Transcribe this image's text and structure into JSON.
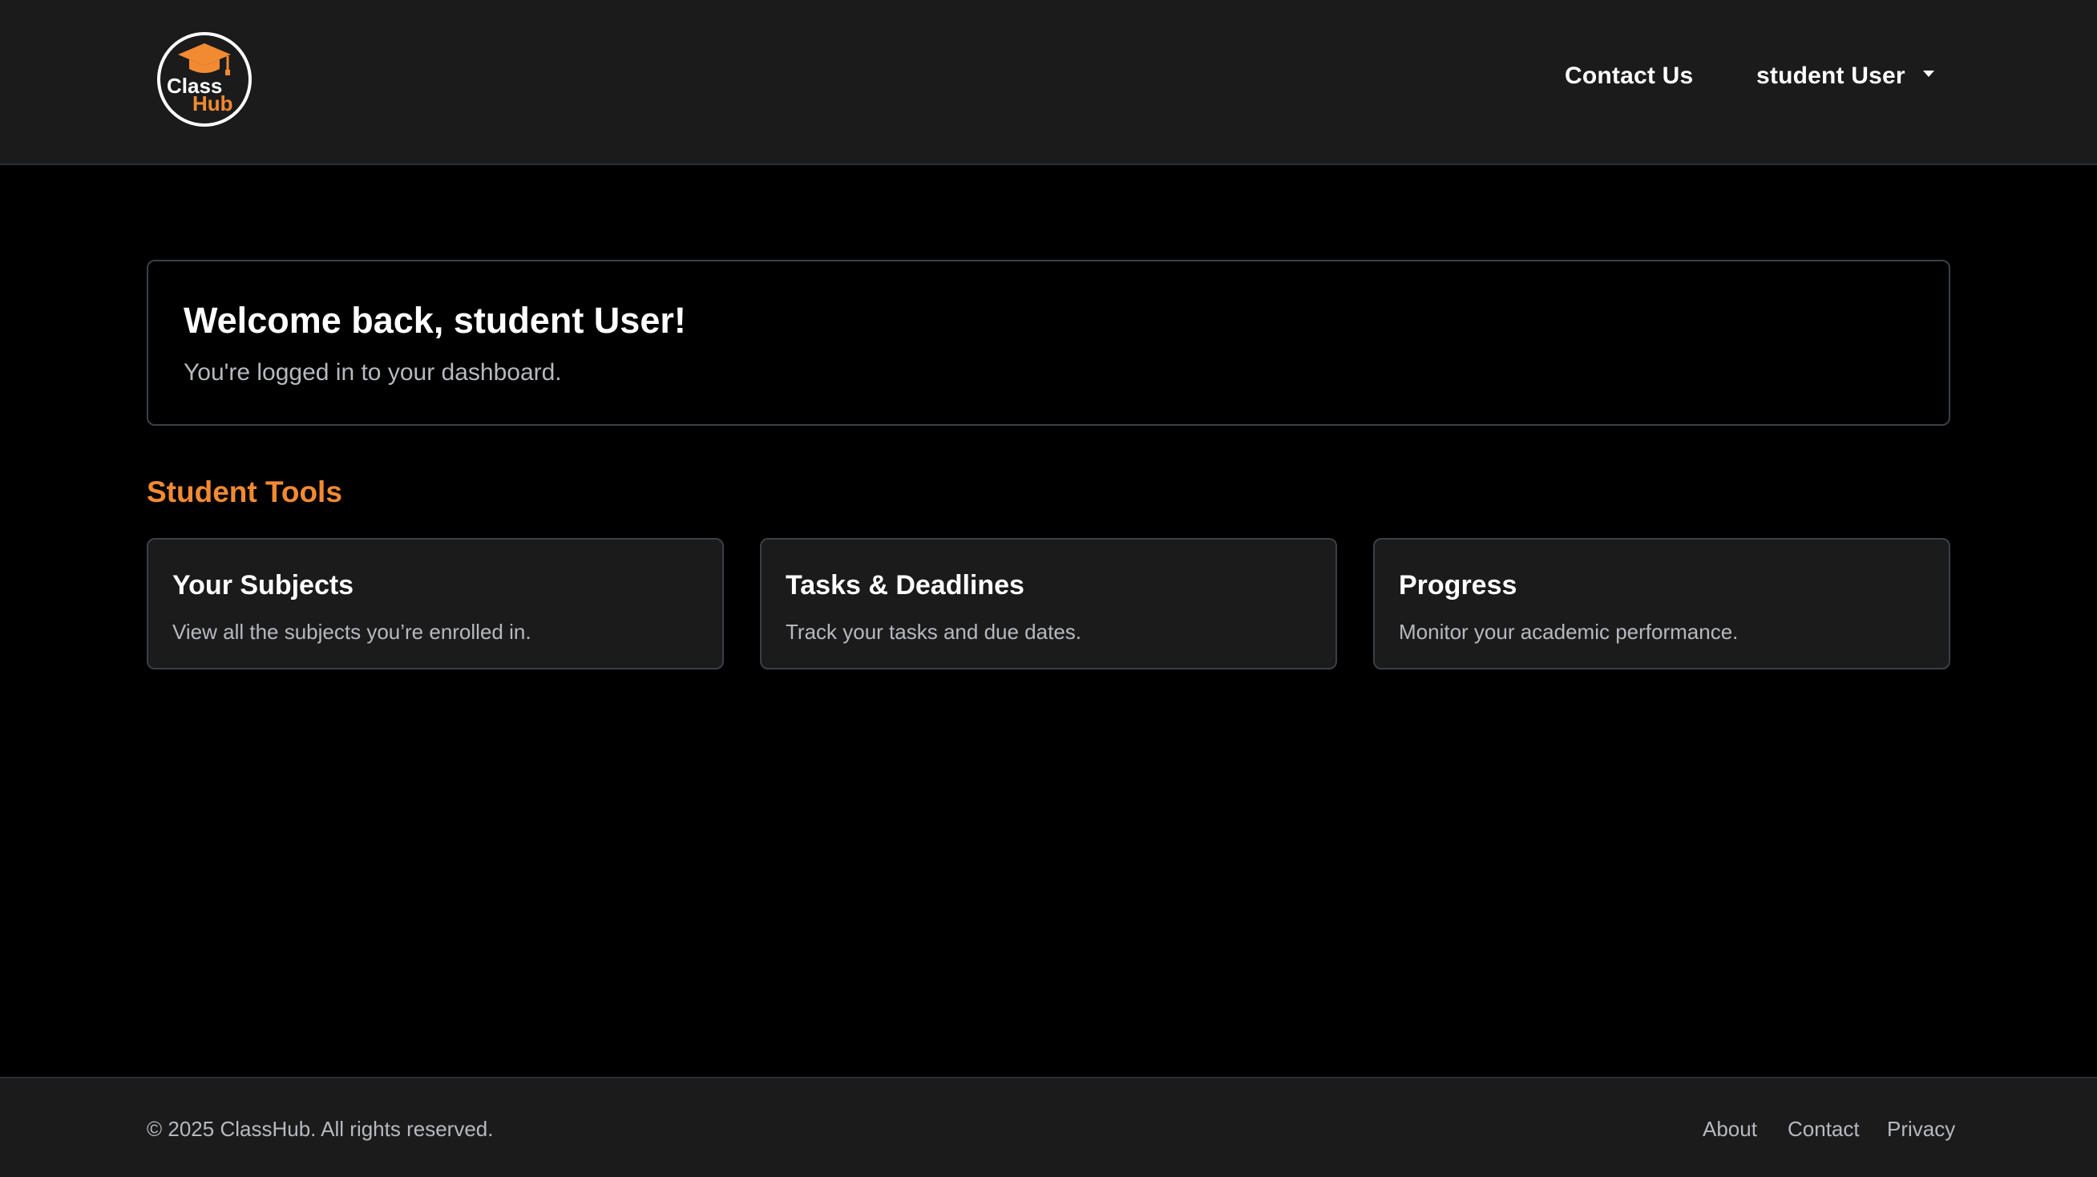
{
  "brand": {
    "logo_word1": "Class",
    "logo_word2": "Hub",
    "accent_color": "#f28a32"
  },
  "nav": {
    "contact_label": "Contact Us",
    "user_label": "student User"
  },
  "welcome": {
    "title": "Welcome back, student User!",
    "subtitle": "You're logged in to your dashboard."
  },
  "tools": {
    "section_title": "Student Tools",
    "cards": [
      {
        "title": "Your Subjects",
        "description": "View all the subjects you’re enrolled in."
      },
      {
        "title": "Tasks & Deadlines",
        "description": "Track your tasks and due dates."
      },
      {
        "title": "Progress",
        "description": "Monitor your academic performance."
      }
    ]
  },
  "footer": {
    "copyright": "© 2025 ClassHub. All rights reserved.",
    "links": [
      "About",
      "Contact",
      "Privacy"
    ]
  }
}
